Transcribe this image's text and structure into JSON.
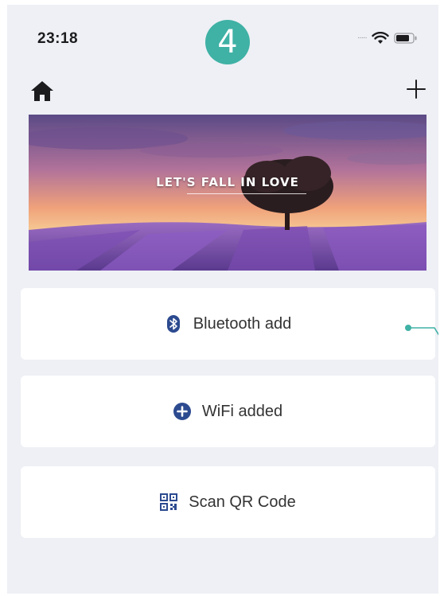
{
  "status_bar": {
    "time": "23:18"
  },
  "annotation": {
    "step_number": "4"
  },
  "nav": {
    "add_label": "+"
  },
  "banner": {
    "caption": "LET'S FALL IN LOVE"
  },
  "options": [
    {
      "label": "Bluetooth add",
      "icon": "bluetooth-icon"
    },
    {
      "label": "WiFi added",
      "icon": "plus-circle-icon"
    },
    {
      "label": "Scan QR Code",
      "icon": "qr-code-icon"
    }
  ],
  "colors": {
    "accent": "#2c4a8f",
    "badge": "#3fb1a5",
    "background": "#eef0f5"
  }
}
